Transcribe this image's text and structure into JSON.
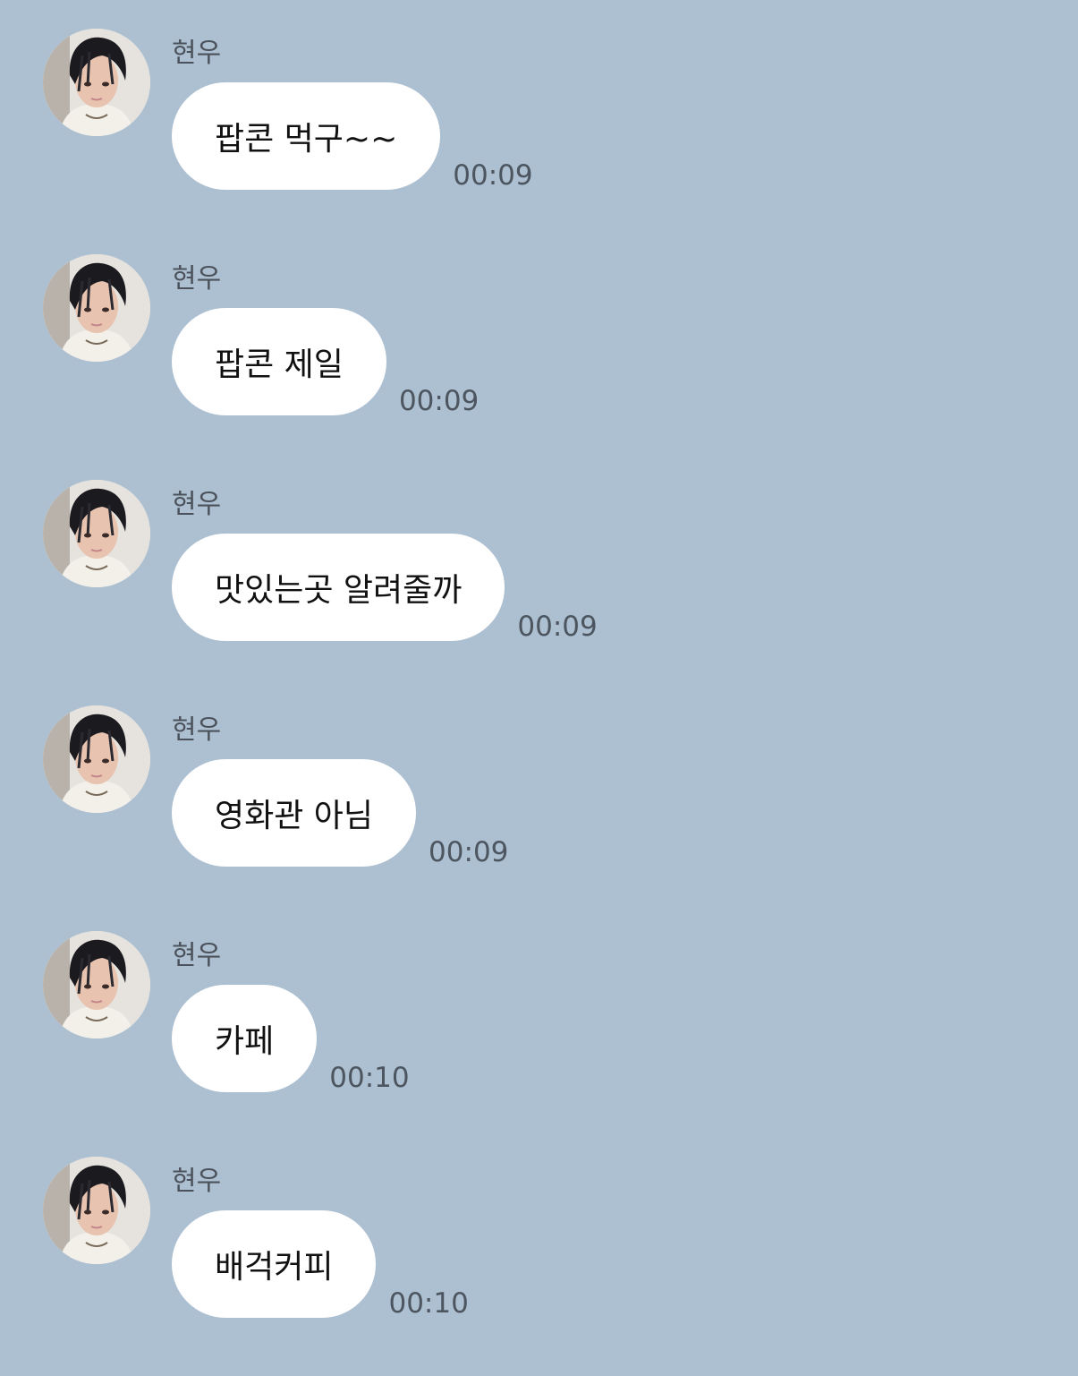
{
  "theme": {
    "background": "#adc0d1",
    "bubble": "#ffffff",
    "sender_color": "#4b525b",
    "time_color": "#4d5660"
  },
  "messages": [
    {
      "sender": "현우",
      "text": "팝콘 먹구~~",
      "time": "00:09",
      "avatar_icon": "profile-photo"
    },
    {
      "sender": "현우",
      "text": "팝콘 제일",
      "time": "00:09",
      "avatar_icon": "profile-photo"
    },
    {
      "sender": "현우",
      "text": "맛있는곳 알려줄까",
      "time": "00:09",
      "avatar_icon": "profile-photo"
    },
    {
      "sender": "현우",
      "text": "영화관 아님",
      "time": "00:09",
      "avatar_icon": "profile-photo"
    },
    {
      "sender": "현우",
      "text": "카페",
      "time": "00:10",
      "avatar_icon": "profile-photo"
    },
    {
      "sender": "현우",
      "text": "배걱커피",
      "time": "00:10",
      "avatar_icon": "profile-photo"
    }
  ]
}
